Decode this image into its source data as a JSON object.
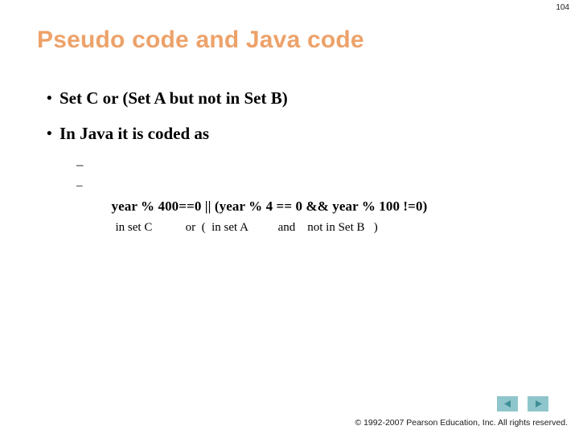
{
  "slide": {
    "page_number": "104",
    "title": "Pseudo code and Java code",
    "title_color": "#eda26a",
    "background_color": "#ffffff"
  },
  "bullets": [
    {
      "marker": "•",
      "text": "Set C or (Set A but not in Set B)"
    },
    {
      "marker": "•",
      "text": "In Java it is coded as"
    }
  ],
  "sub_bullets": [
    {
      "marker": "–",
      "text": "year % 400==0 || (year % 4 == 0 && year % 100 !=0)"
    },
    {
      "marker": "–",
      "text": "in set C           or  (  in set A          and    not in Set B   )"
    }
  ],
  "footer": {
    "copyright": "© 1992-2007 Pearson Education, Inc.  All rights reserved."
  },
  "navigation": {
    "previous_label": "previous-slide",
    "next_label": "next-slide",
    "button_color": "#8fc6cb",
    "arrow_color": "#3f8f96"
  }
}
